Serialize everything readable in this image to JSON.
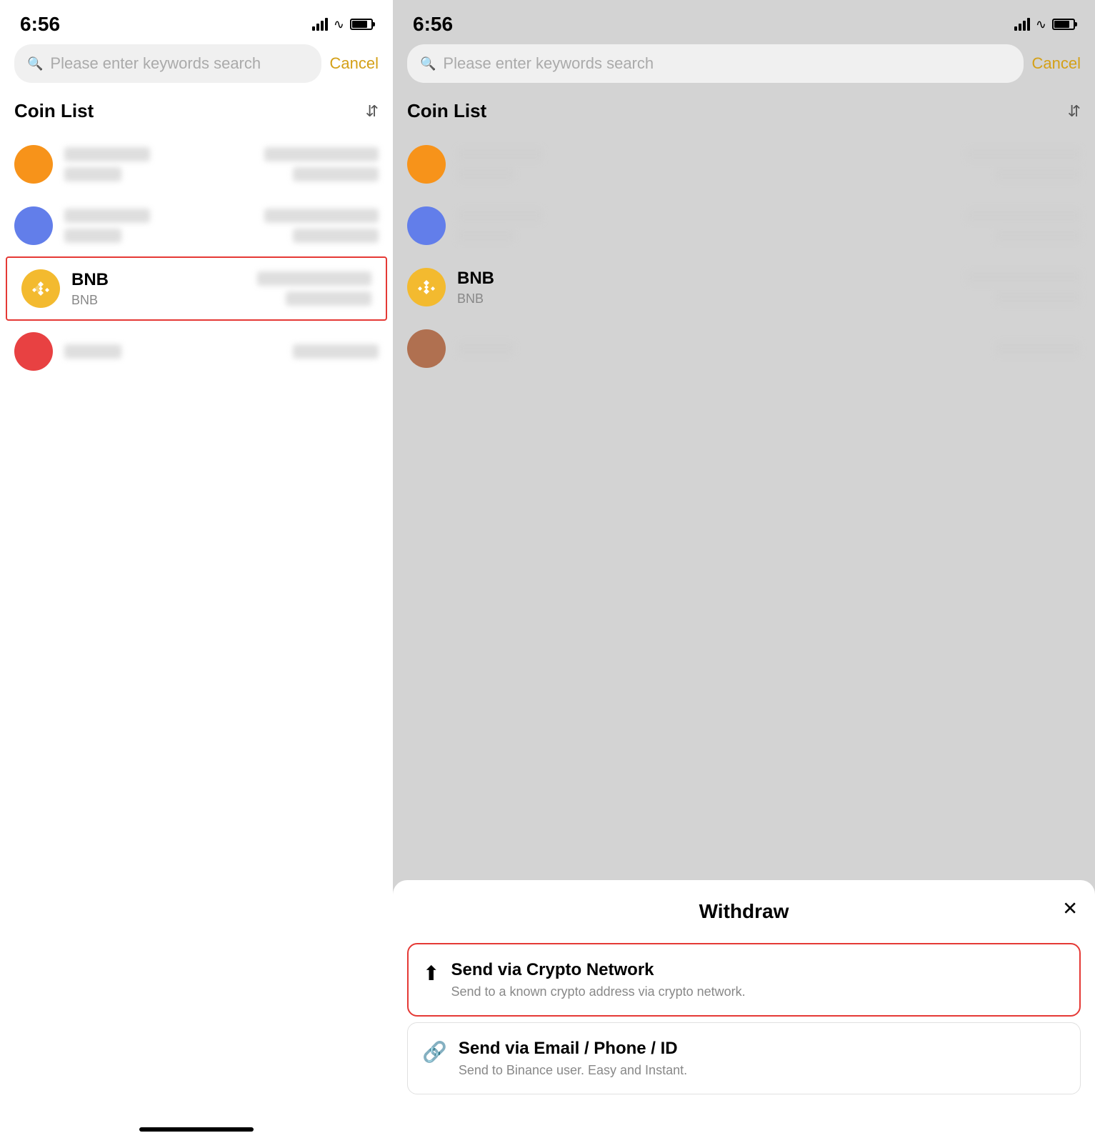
{
  "left": {
    "time": "6:56",
    "search_placeholder": "Please enter keywords search",
    "cancel_label": "Cancel",
    "coin_list_title": "Coin List",
    "coins": [
      {
        "id": "coin1",
        "color": "orange",
        "name": "",
        "symbol": "",
        "blurred": true
      },
      {
        "id": "coin2",
        "color": "blue",
        "name": "",
        "symbol": "",
        "blurred": true
      },
      {
        "id": "bnb",
        "color": "yellow",
        "name": "BNB",
        "symbol": "BNB",
        "blurred": false,
        "selected": true
      },
      {
        "id": "coin4",
        "color": "red",
        "name": "",
        "symbol": "",
        "blurred": true
      }
    ]
  },
  "right": {
    "time": "6:56",
    "search_placeholder": "Please enter keywords search",
    "cancel_label": "Cancel",
    "coin_list_title": "Coin List",
    "modal": {
      "title": "Withdraw",
      "options": [
        {
          "id": "crypto-network",
          "title": "Send via Crypto Network",
          "desc": "Send to a known crypto address via crypto network.",
          "highlighted": true
        },
        {
          "id": "email-phone",
          "title": "Send via Email / Phone / ID",
          "desc": "Send to Binance user. Easy and Instant.",
          "highlighted": false
        }
      ]
    }
  }
}
